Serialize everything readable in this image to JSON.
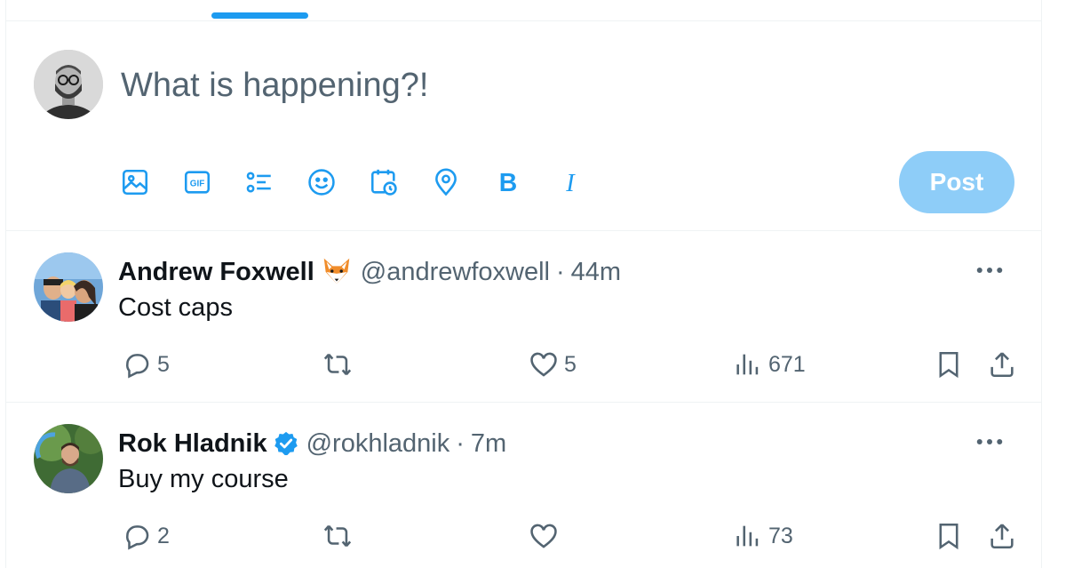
{
  "composer": {
    "placeholder": "What is happening?!",
    "post_label": "Post",
    "tools": [
      {
        "icon": "image-icon"
      },
      {
        "icon": "gif-icon",
        "text": "GIF"
      },
      {
        "icon": "poll-icon"
      },
      {
        "icon": "emoji-icon"
      },
      {
        "icon": "schedule-icon"
      },
      {
        "icon": "location-icon"
      },
      {
        "icon": "bold-icon",
        "text": "B"
      },
      {
        "icon": "italic-icon",
        "text": "I"
      }
    ]
  },
  "colors": {
    "accent": "#1d9bf0",
    "post_disabled": "#8ecdf8",
    "secondary_text": "#536471",
    "verified": "#1d9bf0"
  },
  "tweets": [
    {
      "name": "Andrew Foxwell",
      "badge": "fox-emoji",
      "handle": "@andrewfoxwell",
      "separator": "·",
      "time": "44m",
      "text": "Cost caps",
      "replies": "5",
      "reposts": "",
      "likes": "5",
      "views": "671"
    },
    {
      "name": "Rok Hladnik",
      "badge": "verified-badge",
      "handle": "@rokhladnik",
      "separator": "·",
      "time": "7m",
      "text": "Buy my course",
      "replies": "2",
      "reposts": "",
      "likes": "",
      "views": "73"
    }
  ]
}
